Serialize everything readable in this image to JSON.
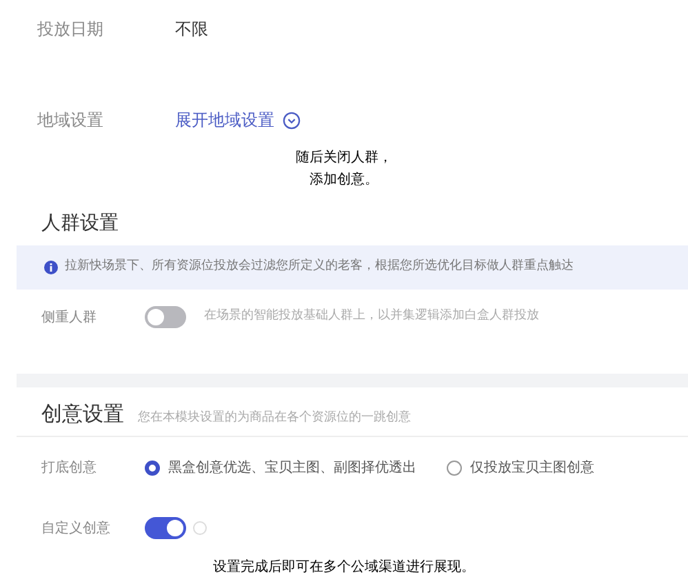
{
  "fields": [
    {
      "label": "投放日期",
      "value": "不限",
      "kind": "text"
    },
    {
      "label": "地域设置",
      "value": "展开地域设置",
      "kind": "link"
    }
  ],
  "caption_top": [
    "随后关闭人群，",
    "添加创意。"
  ],
  "audience": {
    "title": "人群设置",
    "notice": "拉新快场景下、所有资源位投放会过滤您所定义的老客，根据您所选优化目标做人群重点触达",
    "row": {
      "label": "侧重人群",
      "on": false,
      "hint": "在场景的智能投放基础人群上，以并集逻辑添加白盒人群投放"
    }
  },
  "creative": {
    "title": "创意设置",
    "subtitle": "您在本模块设置的为商品在各个资源位的一跳创意",
    "fallback": {
      "label": "打底创意",
      "options": [
        {
          "label": "黑盒创意优选、宝贝主图、副图择优透出",
          "selected": true
        },
        {
          "label": "仅投放宝贝主图创意",
          "selected": false
        }
      ]
    },
    "custom": {
      "label": "自定义创意",
      "on": true
    }
  },
  "caption_bottom": "设置完成后即可在多个公域渠道进行展现。"
}
